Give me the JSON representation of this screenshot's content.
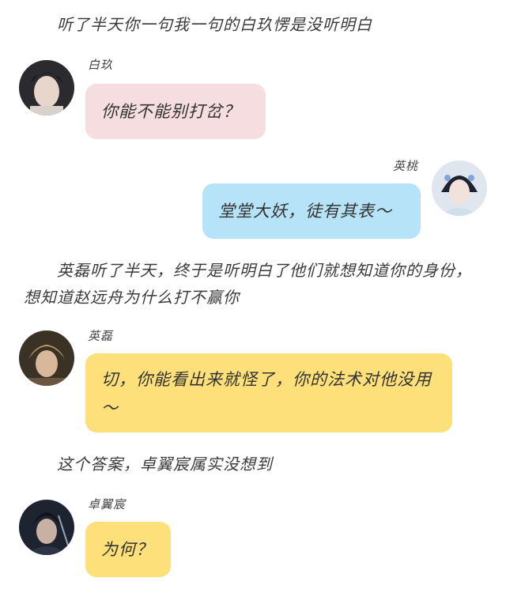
{
  "narration": [
    "听了半天你一句我一句的白玖愣是没听明白",
    "英磊听了半天，终于是听明白了他们就想知道你的身份，想知道赵远舟为什么打不赢你",
    "这个答案，卓翼宸属实没想到"
  ],
  "messages": [
    {
      "speaker": "白玖",
      "text": "你能不能别打岔？",
      "side": "left",
      "bubble_color": "#f5dde0"
    },
    {
      "speaker": "英桃",
      "text": "堂堂大妖，徒有其表～",
      "side": "right",
      "bubble_color": "#b6e3f7"
    },
    {
      "speaker": "英磊",
      "text": "切，你能看出来就怪了，你的法术对他没用～",
      "side": "left",
      "bubble_color": "#fde07a"
    },
    {
      "speaker": "卓翼宸",
      "text": "为何？",
      "side": "left",
      "bubble_color": "#fde07a"
    }
  ]
}
